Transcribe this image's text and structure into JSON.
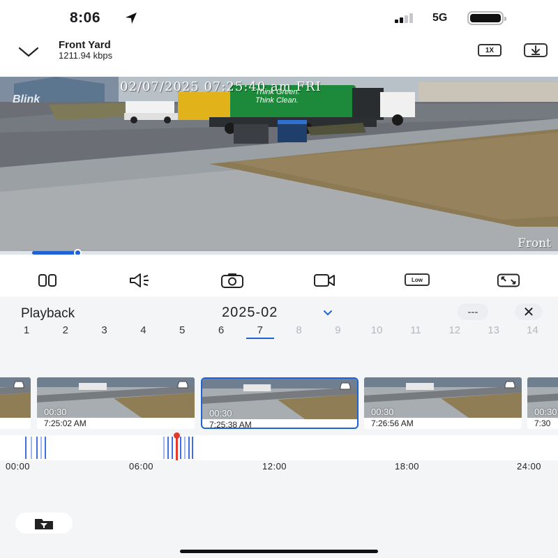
{
  "status_bar": {
    "time": "8:06",
    "network": "5G"
  },
  "header": {
    "title": "Front Yard",
    "bitrate": "1211.94 kbps",
    "speed_label": "1X"
  },
  "video": {
    "overlay_timestamp": "02/07/2025 07:25:40 am FRI",
    "overlay_brand": "Blink",
    "camera_label": "Front",
    "truck_text_line1": "Think Green.",
    "truck_text_line2": "Think Clean.",
    "progress": 0.14
  },
  "controls": {
    "pause_icon": "pause-icon",
    "volume_icon": "volume-muted-icon",
    "snapshot_icon": "camera-icon",
    "record_icon": "video-record-icon",
    "quality_label": "Low",
    "fullscreen_icon": "expand-icon"
  },
  "playback": {
    "title": "Playback",
    "month": "2025-02",
    "more_label": "---",
    "close_label": "✕",
    "days": [
      "1",
      "2",
      "3",
      "4",
      "5",
      "6",
      "7",
      "8",
      "9",
      "10",
      "11",
      "12",
      "13",
      "14"
    ],
    "selected_day": "7",
    "last_enabled_day": 7,
    "clips": [
      {
        "duration": "",
        "time": ""
      },
      {
        "duration": "00:30",
        "time": "7:25:02 AM"
      },
      {
        "duration": "00:30",
        "time": "7:25:38 AM",
        "selected": true
      },
      {
        "duration": "00:30",
        "time": "7:26:56 AM"
      },
      {
        "duration": "00:30",
        "time": "7:30"
      }
    ],
    "timeline_labels": [
      "00:00",
      "06:00",
      "12:00",
      "18:00",
      "24:00"
    ],
    "accent_color": "#1f62d6",
    "playhead_color": "#e5392c"
  }
}
